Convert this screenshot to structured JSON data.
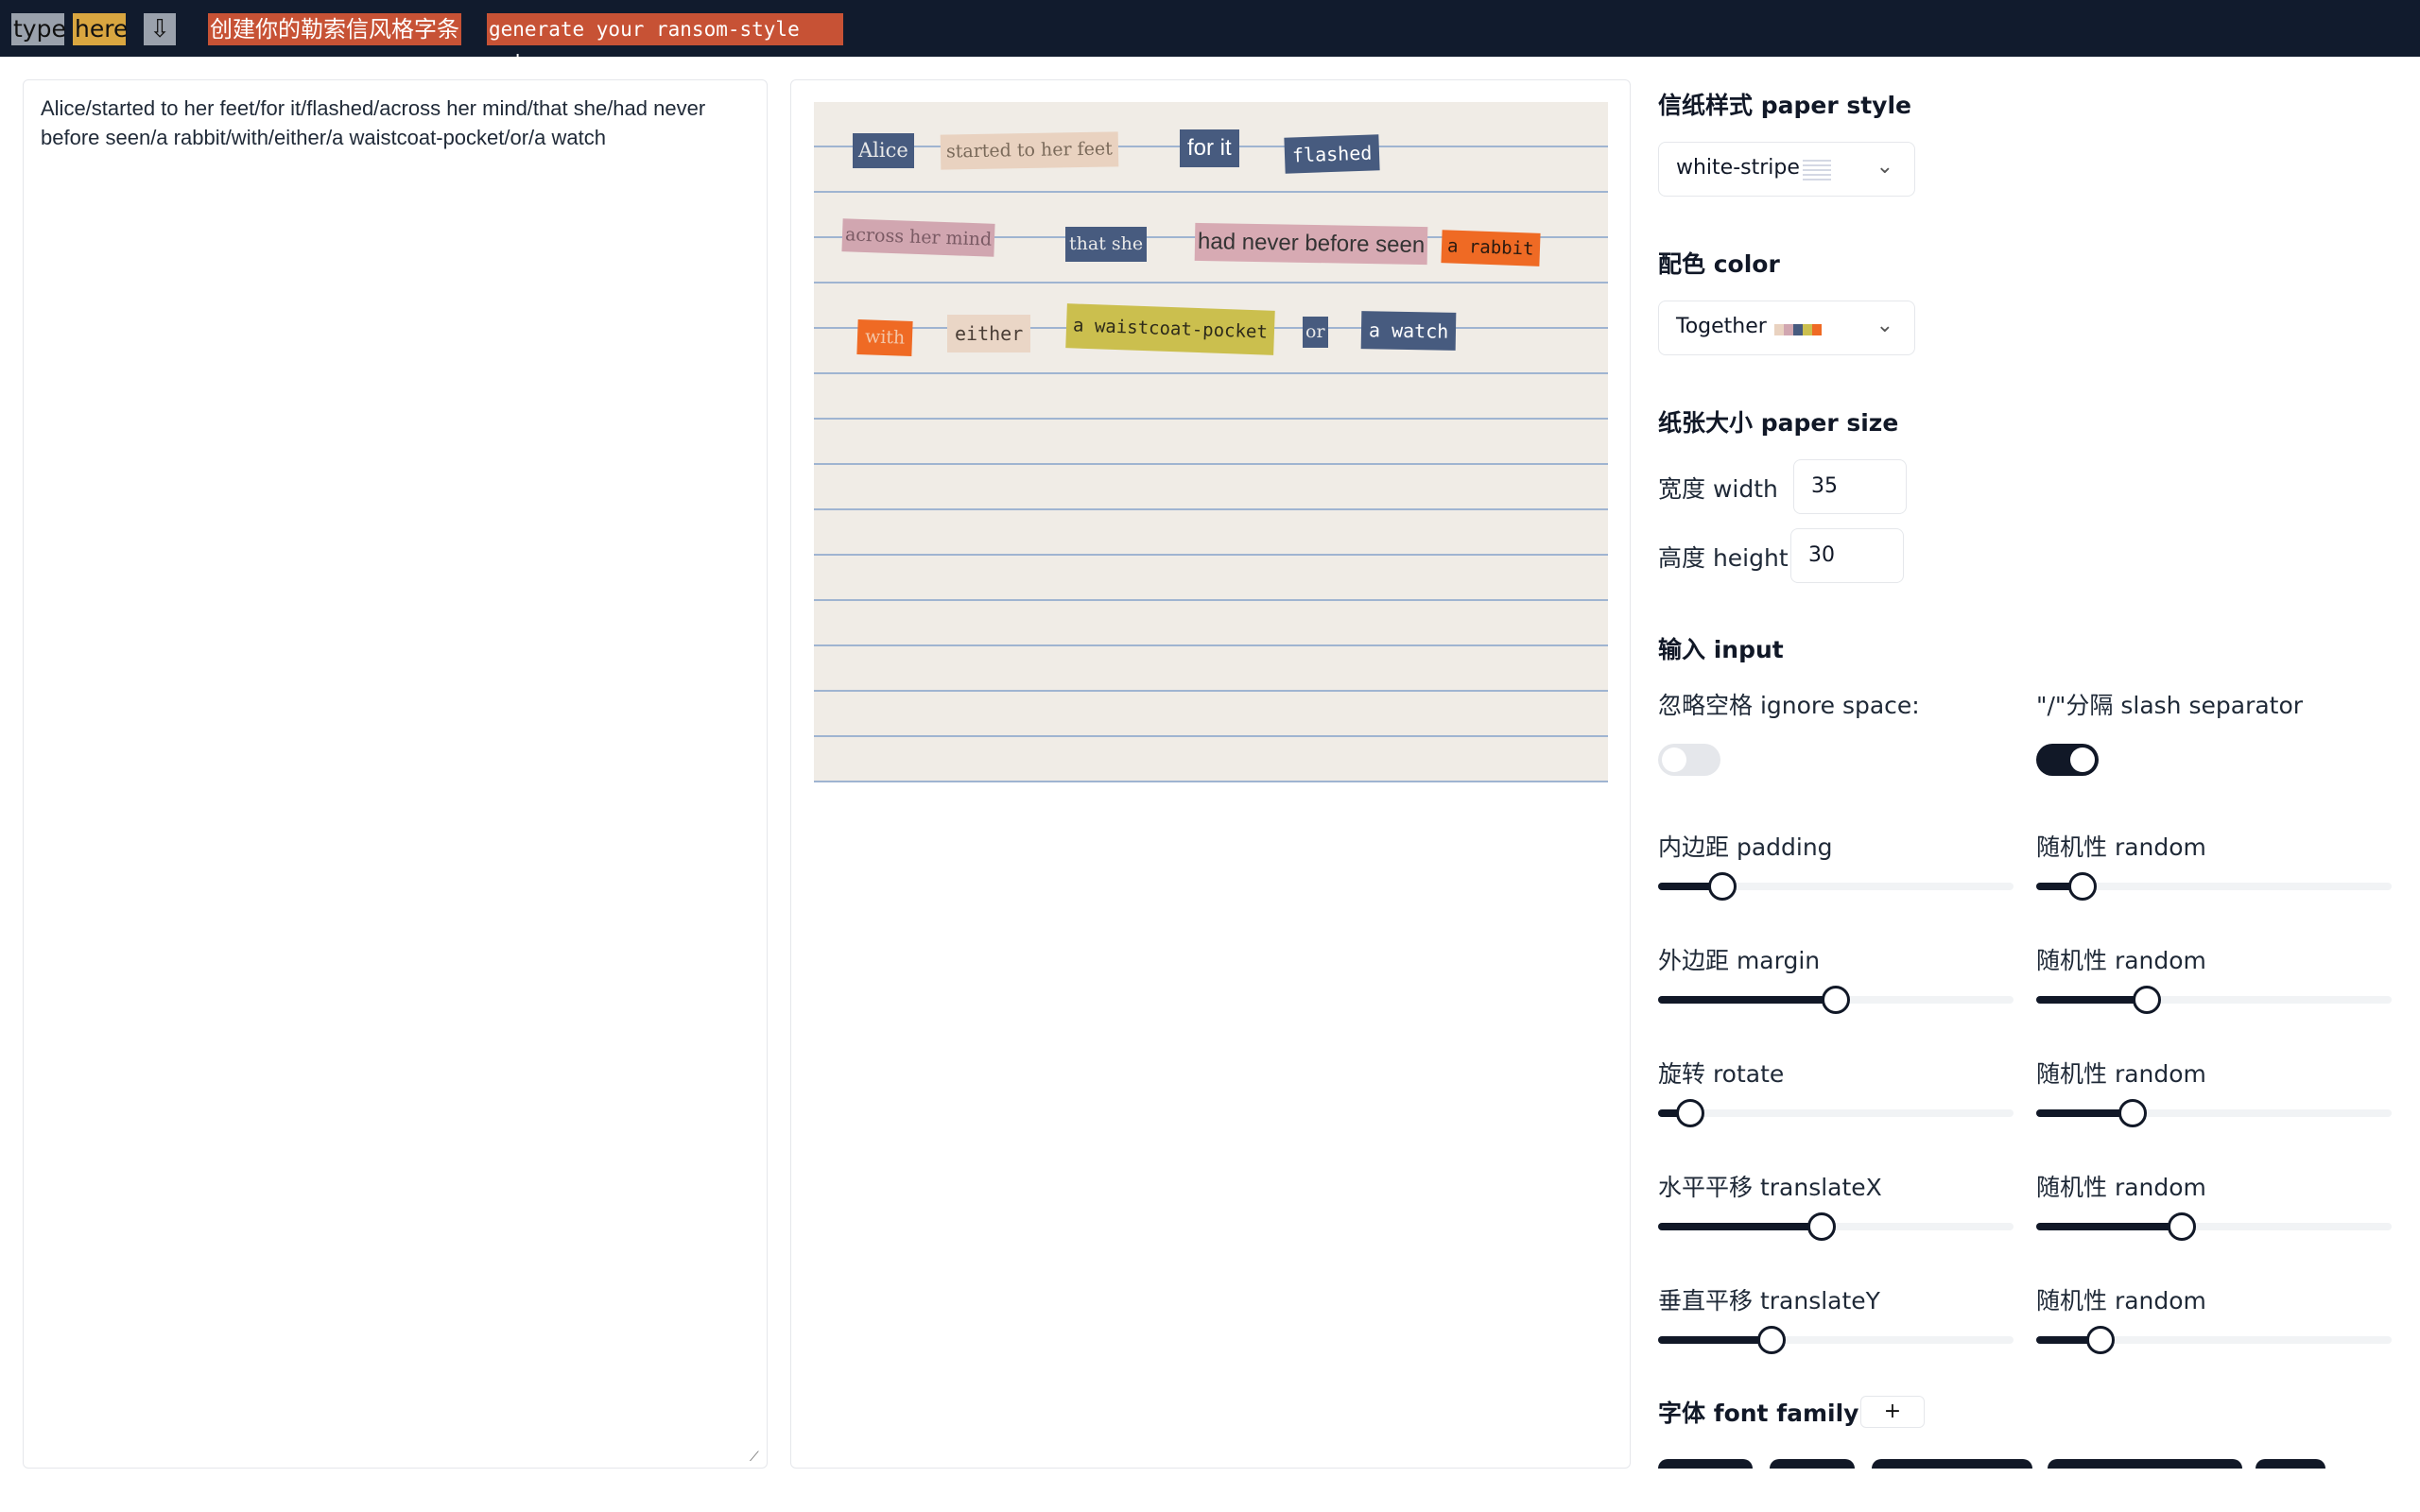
{
  "topbar": {
    "type": "type",
    "here": "here",
    "download_icon": "⇩",
    "title_zh": "创建你的勒索信风格字条",
    "title_en": "generate your ransom-style note"
  },
  "editor": {
    "text": "Alice/started to her feet/for it/flashed/across her mind/that she/had never before seen/a rabbit/with/either/a waistcoat-pocket/or/a watch"
  },
  "preview": {
    "words": [
      {
        "text": "Alice",
        "bg": "#475b7f",
        "fg": "#e8e8e8"
      },
      {
        "text": "started to her feet",
        "bg": "#e9d2c0",
        "fg": "#7a6a5a"
      },
      {
        "text": "for it",
        "bg": "#475b7f",
        "fg": "#ffffff"
      },
      {
        "text": "flashed",
        "bg": "#475b7f",
        "fg": "#ffffff"
      },
      {
        "text": "across her mind",
        "bg": "#d1a6b0",
        "fg": "#7a5a64"
      },
      {
        "text": "that she",
        "bg": "#475b7f",
        "fg": "#e8e8e8"
      },
      {
        "text": "had never before seen",
        "bg": "#d7aab3",
        "fg": "#333333"
      },
      {
        "text": "a rabbit",
        "bg": "#ef6a24",
        "fg": "#2a1a10"
      },
      {
        "text": "with",
        "bg": "#ef6a24",
        "fg": "#f3c6a8"
      },
      {
        "text": "either",
        "bg": "#ead6c6",
        "fg": "#4a3e36"
      },
      {
        "text": "a waistcoat-pocket",
        "bg": "#cbbf4e",
        "fg": "#2d2a1a"
      },
      {
        "text": "or",
        "bg": "#475b7f",
        "fg": "#e8e8e8"
      },
      {
        "text": "a watch",
        "bg": "#475b7f",
        "fg": "#ffffff"
      }
    ]
  },
  "controls": {
    "paper_style": {
      "label": "信纸样式 paper style",
      "value": "white-stripe"
    },
    "color": {
      "label": "配色 color",
      "value": "Together",
      "swatches": [
        "#e9d2c0",
        "#d1a6b0",
        "#475b7f",
        "#cbbf4e",
        "#ef6a24"
      ]
    },
    "paper_size": {
      "label": "纸张大小 paper size",
      "width_label": "宽度 width",
      "width": "35",
      "height_label": "高度 height",
      "height": "30"
    },
    "input": {
      "label": "输入 input",
      "ignore_space_label": "忽略空格 ignore space:",
      "ignore_space": false,
      "slash_label": "\"/\"分隔 slash separator",
      "slash": true
    },
    "sliders": [
      {
        "label": "内边距 padding",
        "value": 0.18,
        "random_label": "随机性 random",
        "random": 0.13
      },
      {
        "label": "外边距 margin",
        "value": 0.5,
        "random_label": "随机性 random",
        "random": 0.31
      },
      {
        "label": "旋转 rotate",
        "value": 0.09,
        "random_label": "随机性 random",
        "random": 0.27
      },
      {
        "label": "水平平移 translateX",
        "value": 0.46,
        "random_label": "随机性 random",
        "random": 0.41
      },
      {
        "label": "垂直平移 translateY",
        "value": 0.32,
        "random_label": "随机性 random",
        "random": 0.18
      }
    ],
    "font_family": {
      "label": "字体 font family",
      "add_label": "+"
    }
  }
}
